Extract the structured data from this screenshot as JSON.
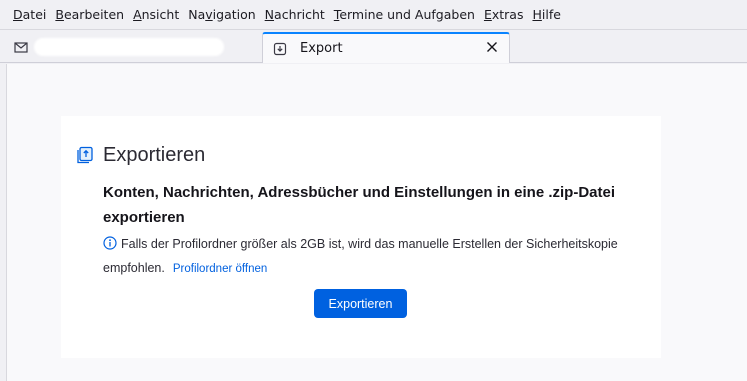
{
  "menubar": {
    "items": [
      {
        "underline": "D",
        "rest": "atei"
      },
      {
        "underline": "B",
        "rest": "earbeiten"
      },
      {
        "underline": "A",
        "rest": "nsicht"
      },
      {
        "pre": "Na",
        "underline": "v",
        "rest": "igation"
      },
      {
        "underline": "N",
        "rest": "achricht"
      },
      {
        "underline": "T",
        "rest": "ermine und Aufgaben"
      },
      {
        "underline": "E",
        "rest": "xtras"
      },
      {
        "underline": "H",
        "rest": "ilfe"
      }
    ]
  },
  "tabs": {
    "active": {
      "label": "Export"
    }
  },
  "export_card": {
    "title": "Exportieren",
    "heading": "Konten, Nachrichten, Adressbücher und Einstellungen in eine .zip-Datei exportieren",
    "info_text": "Falls der Profilordner größer als 2GB ist, wird das manuelle Erstellen der Sicherheitskopie empfohlen.",
    "link_label": "Profilordner öffnen",
    "button_label": "Exportieren"
  },
  "colors": {
    "accent": "#0061e0",
    "tab_indicator": "#0a84ff",
    "link": "#0060df"
  }
}
